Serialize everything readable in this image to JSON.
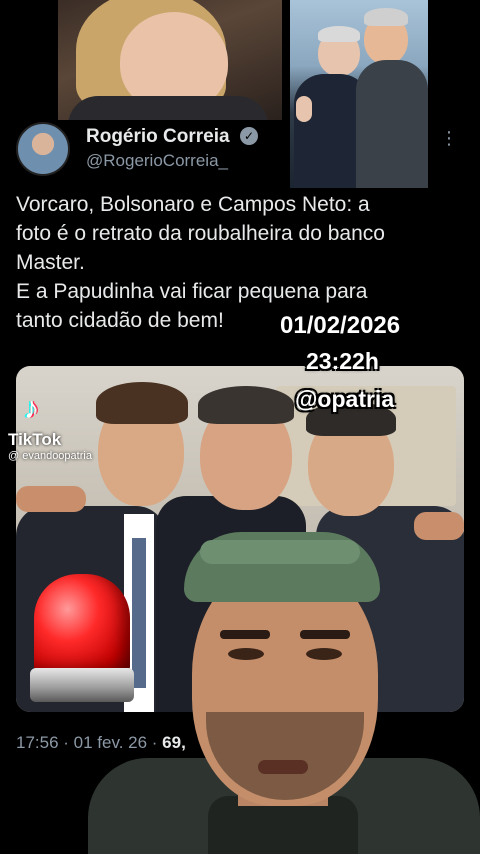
{
  "tweet": {
    "author_name": "Rogério Correia",
    "author_handle": "@RogerioCorreia_",
    "text_lines": [
      "Vorcaro, Bolsonaro e Campos Neto: a",
      "foto é o retrato da roubalheira do banco",
      "Master.",
      "E a Papudinha vai ficar pequena para",
      "tanto cidadão de bem!"
    ],
    "time": "17:56",
    "date": "01 fev. 26",
    "views_partial": "69,"
  },
  "overlay": {
    "date": "01/02/2026",
    "time": "23:22h",
    "handle": "@opatria"
  },
  "tiktok": {
    "label": "TikTok",
    "user": "@ evandoopatria",
    "icon": "tiktok-note-icon"
  },
  "icons": {
    "verified": "verified-badge-icon",
    "more": "more-options-icon",
    "siren": "red-siren-icon"
  },
  "colors": {
    "background": "#000000",
    "text_primary": "#e7e9ea",
    "text_secondary": "#8b98a5",
    "siren_red": "#ff2a2a"
  }
}
